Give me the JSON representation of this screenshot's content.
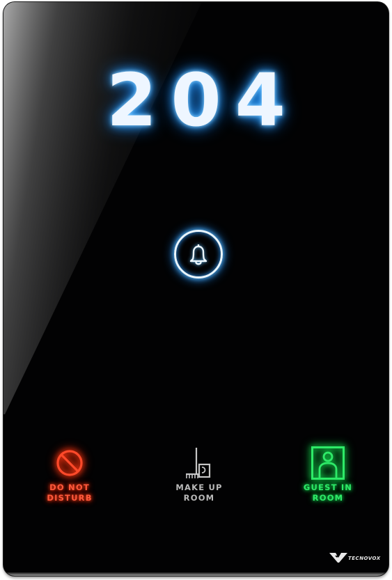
{
  "display": {
    "room_number": "204"
  },
  "controls": {
    "call_button_icon": "bell-icon"
  },
  "status_indicators": [
    {
      "icon": "no-entry-icon",
      "line1": "DO NOT",
      "line2": "DISTURB",
      "color": "#ff4a2a",
      "lit": true
    },
    {
      "icon": "broom-bucket-icon",
      "line1": "MAKE UP",
      "line2": "ROOM",
      "color": "#b9b9b9",
      "lit": false
    },
    {
      "icon": "person-in-room-icon",
      "line1": "GUEST IN",
      "line2": "ROOM",
      "color": "#2eea68",
      "lit": true
    }
  ],
  "brand": {
    "name": "TECNOVOX"
  },
  "colors": {
    "panel": "#020203",
    "number_glow": "#1486ff",
    "dnd": "#ff4a2a",
    "guest_in_room": "#2eea68",
    "make_up_room": "#b9b9b9"
  }
}
